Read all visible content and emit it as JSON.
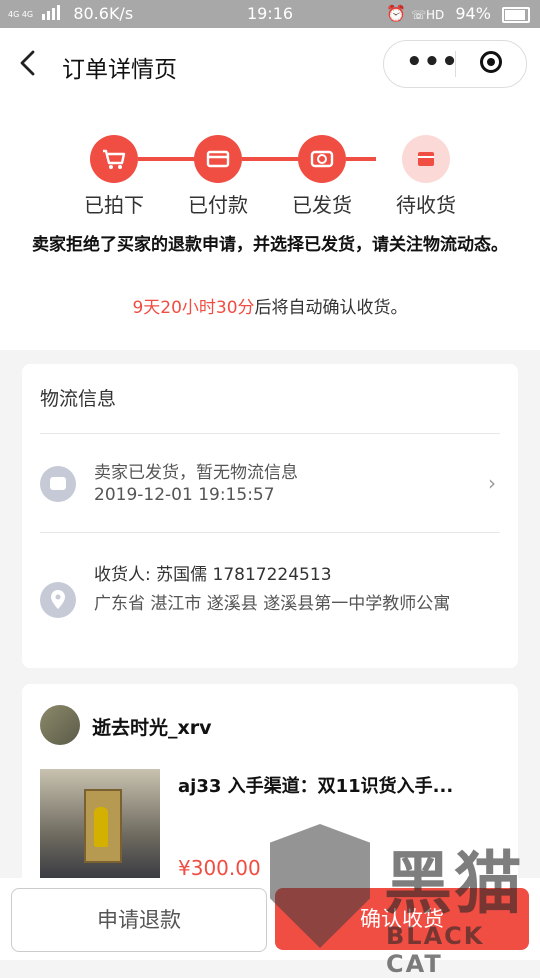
{
  "status_bar": {
    "network": "80.6K/s",
    "time": "19:16",
    "battery": "94%",
    "signal_text": "4G 4G"
  },
  "nav": {
    "title": "订单详情页",
    "more_label": "•••"
  },
  "steps": [
    {
      "label": "已拍下"
    },
    {
      "label": "已付款"
    },
    {
      "label": "已发货"
    },
    {
      "label": "待收货"
    }
  ],
  "notice": "卖家拒绝了买家的退款申请，并选择已发货，请关注物流动态。",
  "auto_confirm": {
    "countdown": "9天20小时30分",
    "suffix": "后将自动确认收货。"
  },
  "logistics": {
    "title": "物流信息",
    "status": "卖家已发货，暂无物流信息",
    "timestamp": "2019-12-01 19:15:57",
    "receiver": "收货人: 苏国儒   17817224513",
    "address": "广东省 湛江市 遂溪县 遂溪县第一中学教师公寓"
  },
  "order": {
    "seller": "逝去时光_xrv",
    "product_title": "aj33 入手渠道：双11识货入手...",
    "price": "¥300.00"
  },
  "actions": {
    "refund_label": "申请退款",
    "confirm_label": "确认收货"
  },
  "watermark": {
    "cn": "黑猫",
    "en": "BLACK CAT"
  },
  "colors": {
    "accent": "#f04d43",
    "pending": "#fbd9d6",
    "icon_bg": "#c6c9d6"
  }
}
